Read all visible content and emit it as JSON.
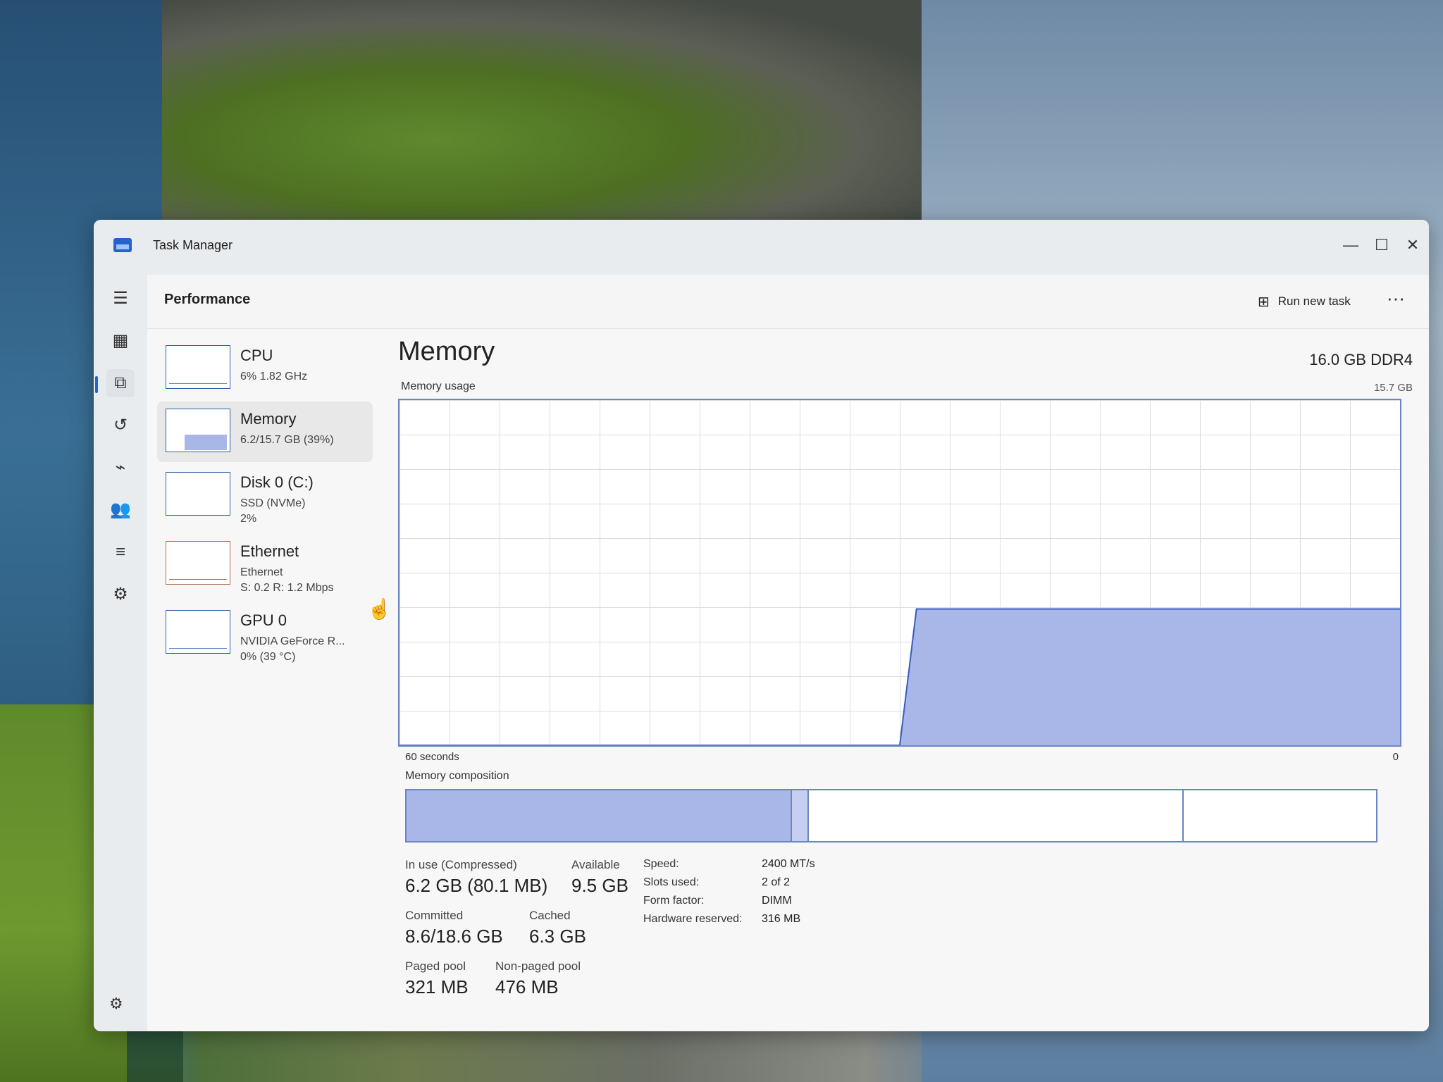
{
  "window": {
    "title": "Task Manager",
    "controls": {
      "minimize": "—",
      "maximize": "☐",
      "close": "✕"
    },
    "accent": "#2563c9"
  },
  "header": {
    "page_title": "Performance",
    "run_new_task_label": "Run new task",
    "more_label": "···"
  },
  "nav": {
    "icons": [
      "☰",
      "▦",
      "⧉",
      "↺",
      "⌁",
      "👥",
      "≡",
      "⚙"
    ],
    "settings_icon": "⚙"
  },
  "devices": [
    {
      "title": "CPU",
      "line1": "6% 1.82 GHz",
      "line2": ""
    },
    {
      "title": "Memory",
      "line1": "6.2/15.7 GB (39%)",
      "line2": ""
    },
    {
      "title": "Disk 0 (C:)",
      "line1": "SSD (NVMe)",
      "line2": "2%"
    },
    {
      "title": "Ethernet",
      "line1": "Ethernet",
      "line2": "S: 0.2 R: 1.2 Mbps"
    },
    {
      "title": "GPU 0",
      "line1": "NVIDIA GeForce R...",
      "line2": "0% (39 °C)"
    }
  ],
  "memory": {
    "title": "Memory",
    "capacity": "16.0 GB DDR4",
    "usage_label": "Memory usage",
    "usage_max": "15.7 GB",
    "axis_left": "60 seconds",
    "axis_right": "0",
    "composition_label": "Memory composition",
    "stats": {
      "in_use_label": "In use (Compressed)",
      "in_use_value": "6.2 GB (80.1 MB)",
      "available_label": "Available",
      "available_value": "9.5 GB",
      "committed_label": "Committed",
      "committed_value": "8.6/18.6 GB",
      "cached_label": "Cached",
      "cached_value": "6.3 GB",
      "paged_pool_label": "Paged pool",
      "paged_pool_value": "321 MB",
      "nonpaged_pool_label": "Non-paged pool",
      "nonpaged_pool_value": "476 MB"
    },
    "specs": [
      {
        "label": "Speed:",
        "value": "2400 MT/s"
      },
      {
        "label": "Slots used:",
        "value": "2 of 2"
      },
      {
        "label": "Form factor:",
        "value": "DIMM"
      },
      {
        "label": "Hardware reserved:",
        "value": "316 MB"
      }
    ]
  },
  "chart_data": {
    "type": "area",
    "title": "Memory usage",
    "xlabel": "",
    "ylabel": "",
    "x": [
      60,
      30,
      29,
      20,
      10,
      0
    ],
    "values": [
      0,
      0,
      6.2,
      6.2,
      6.2,
      6.2
    ],
    "ylim": [
      0,
      15.7
    ],
    "xlim": [
      60,
      0
    ],
    "grid": true
  }
}
